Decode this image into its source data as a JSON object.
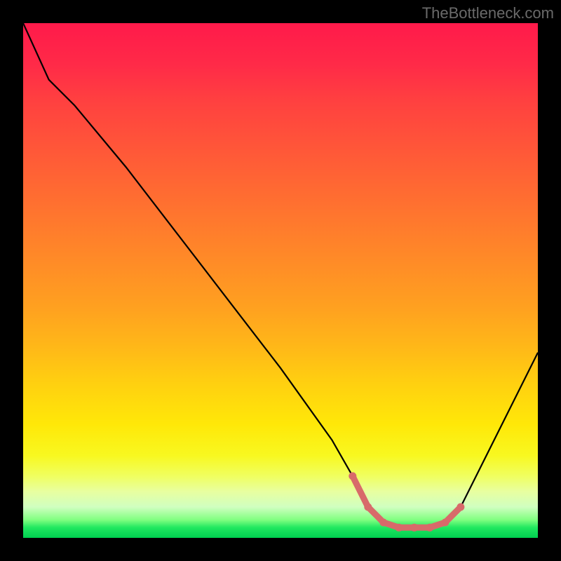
{
  "watermark": "TheBottleneck.com",
  "chart_data": {
    "type": "line",
    "title": "",
    "xlabel": "",
    "ylabel": "",
    "xlim": [
      0,
      100
    ],
    "ylim": [
      0,
      100
    ],
    "grid": false,
    "series": [
      {
        "name": "bottleneck-curve",
        "color": "#000000",
        "x": [
          0,
          5,
          10,
          20,
          30,
          40,
          50,
          60,
          64,
          67,
          70,
          73,
          76,
          79,
          82,
          85,
          100
        ],
        "values": [
          100,
          89,
          84,
          72,
          59,
          46,
          33,
          19,
          12,
          6,
          3,
          2,
          2,
          2,
          3,
          6,
          36
        ]
      }
    ],
    "highlight": {
      "name": "optimal-range",
      "color": "#d86a6a",
      "x": [
        64,
        67,
        70,
        73,
        76,
        79,
        82,
        85
      ],
      "values": [
        12,
        6,
        3,
        2,
        2,
        2,
        3,
        6
      ]
    },
    "background_gradient": {
      "top": "#ff1a4a",
      "mid": "#ffd010",
      "bottom": "#00d050"
    }
  }
}
